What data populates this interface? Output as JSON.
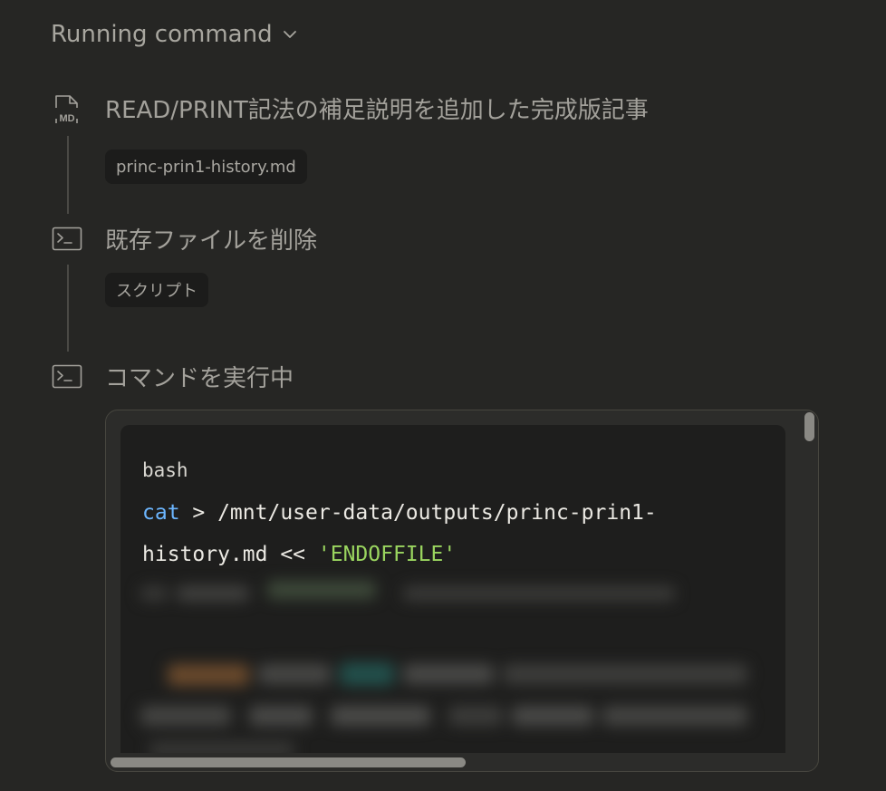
{
  "header": {
    "title": "Running command",
    "chevron_icon": "chevron-down-icon"
  },
  "steps": [
    {
      "icon": "markdown-file-icon",
      "title": "READ/PRINT記法の補足説明を追加した完成版記事",
      "chip": "princ-prin1-history.md"
    },
    {
      "icon": "terminal-icon",
      "title": "既存ファイルを削除",
      "chip": "スクリプト"
    },
    {
      "icon": "terminal-icon",
      "title": "コマンドを実行中"
    }
  ],
  "code": {
    "language": "bash",
    "line1_cmd": "cat",
    "line1_rest": " > /mnt/user-data/outputs/princ-prin1-",
    "line2_rest": "history.md << ",
    "line2_string": "'ENDOFFILE'"
  },
  "colors": {
    "background": "#262624",
    "keyword": "#6cb6ff",
    "string": "#9ad55f"
  }
}
